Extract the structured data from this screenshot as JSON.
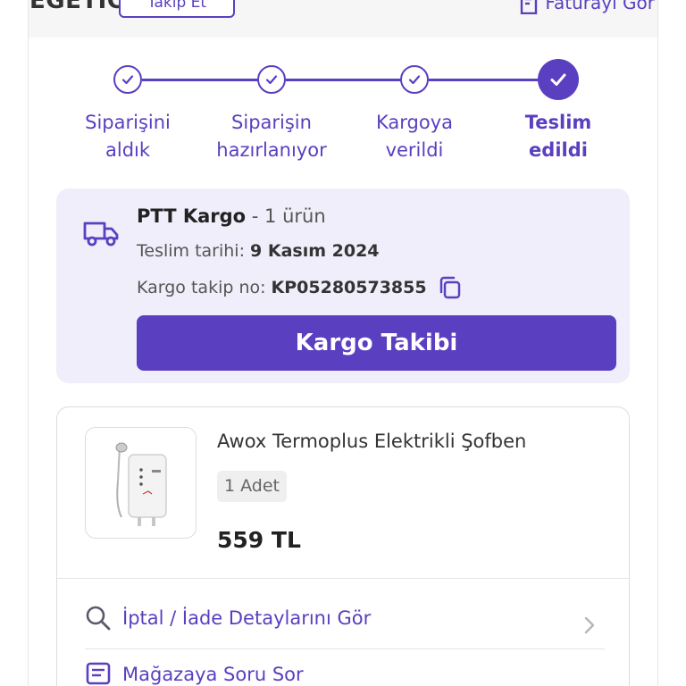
{
  "seller": {
    "name": "EGETIC",
    "follow_label": "Takip Et"
  },
  "invoice": {
    "label": "Faturayı Gör"
  },
  "stepper": {
    "steps": [
      {
        "line1": "Siparişini",
        "line2": "aldık",
        "status": "done"
      },
      {
        "line1": "Siparişin",
        "line2": "hazırlanıyor",
        "status": "done"
      },
      {
        "line1": "Kargoya",
        "line2": "verildi",
        "status": "done"
      },
      {
        "line1": "Teslim",
        "line2": "edildi",
        "status": "current"
      }
    ]
  },
  "cargo": {
    "carrier": "PTT Kargo",
    "item_count": "- 1 ürün",
    "delivery_label": "Teslim tarihi:",
    "delivery_date": "9 Kasım 2024",
    "tracking_label": "Kargo takip no:",
    "tracking_number": "KP05280573855",
    "track_button": "Kargo Takibi"
  },
  "product": {
    "name": "Awox Termoplus Elektrikli Şofben",
    "quantity": "1 Adet",
    "price": "559 TL"
  },
  "actions": {
    "return_details": "İptal / İade Detaylarını Gör",
    "ask_store": "Mağazaya Soru Sor"
  },
  "colors": {
    "accent": "#5a3fc0",
    "cargo_bg": "#efeefa"
  }
}
